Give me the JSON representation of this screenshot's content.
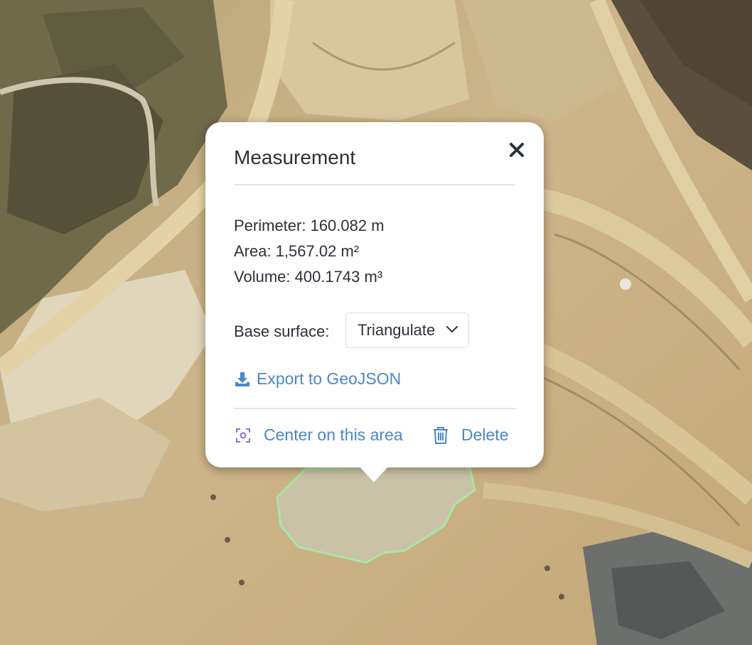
{
  "popup": {
    "title": "Measurement",
    "perimeter": "Perimeter: 160.082 m",
    "area": "Area: 1,567.02 m²",
    "volume": "Volume: 400.1743 m³",
    "base_surface_label": "Base surface:",
    "base_surface_value": "Triangulate",
    "export_label": "Export to GeoJSON",
    "center_label": "Center on this area",
    "delete_label": "Delete"
  },
  "icons": {
    "close": "close-icon",
    "export": "download-icon",
    "center": "focus-icon",
    "delete": "trash-icon",
    "dropdown": "chevron-down-icon"
  },
  "colors": {
    "link": "#4a88c8",
    "center_icon": "#8b6fd6",
    "polygon_stroke": "#a8e6a6"
  }
}
